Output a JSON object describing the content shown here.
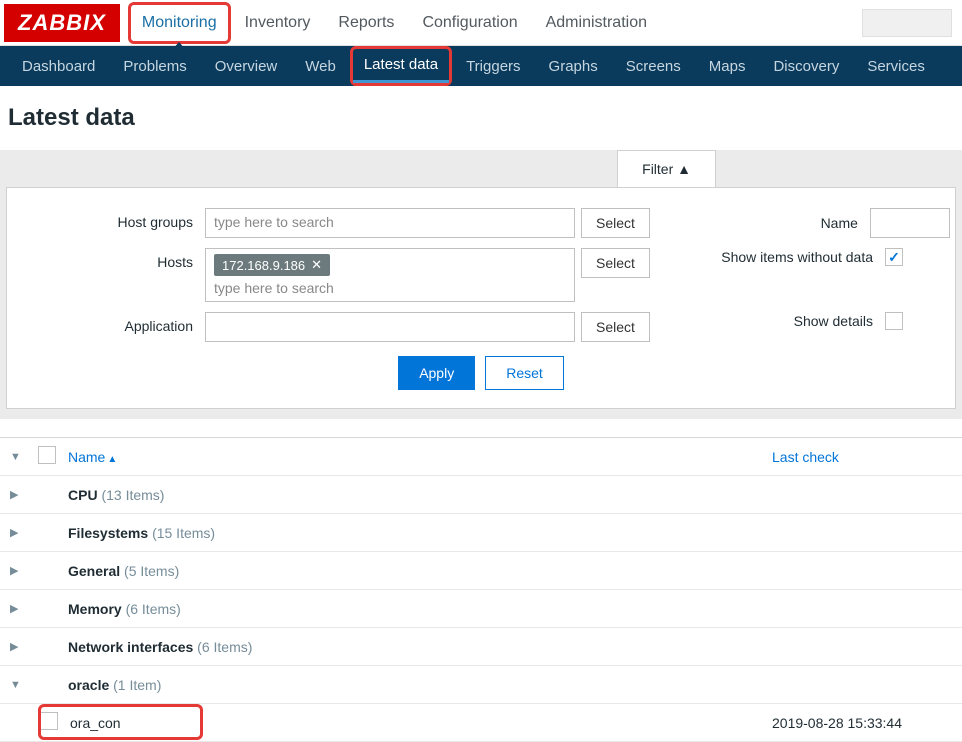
{
  "logo": "ZABBIX",
  "topnav": [
    "Monitoring",
    "Inventory",
    "Reports",
    "Configuration",
    "Administration"
  ],
  "subnav": [
    "Dashboard",
    "Problems",
    "Overview",
    "Web",
    "Latest data",
    "Triggers",
    "Graphs",
    "Screens",
    "Maps",
    "Discovery",
    "Services"
  ],
  "page_title": "Latest data",
  "filter": {
    "tab_label": "Filter ▲",
    "host_groups_label": "Host groups",
    "host_groups_placeholder": "type here to search",
    "hosts_label": "Hosts",
    "hosts_tag": "172.168.9.186",
    "hosts_placeholder": "type here to search",
    "application_label": "Application",
    "select_btn": "Select",
    "name_label": "Name",
    "show_without_data_label": "Show items without data",
    "show_details_label": "Show details",
    "apply_btn": "Apply",
    "reset_btn": "Reset"
  },
  "table": {
    "header_name": "Name",
    "header_lastcheck": "Last check",
    "groups": [
      {
        "name": "CPU",
        "count": "(13 Items)",
        "expanded": false
      },
      {
        "name": "Filesystems",
        "count": "(15 Items)",
        "expanded": false
      },
      {
        "name": "General",
        "count": "(5 Items)",
        "expanded": false
      },
      {
        "name": "Memory",
        "count": "(6 Items)",
        "expanded": false
      },
      {
        "name": "Network interfaces",
        "count": "(6 Items)",
        "expanded": false
      },
      {
        "name": "oracle",
        "count": "(1 Item)",
        "expanded": true
      }
    ],
    "item": {
      "name": "ora_con",
      "lastcheck": "2019-08-28 15:33:44"
    }
  }
}
